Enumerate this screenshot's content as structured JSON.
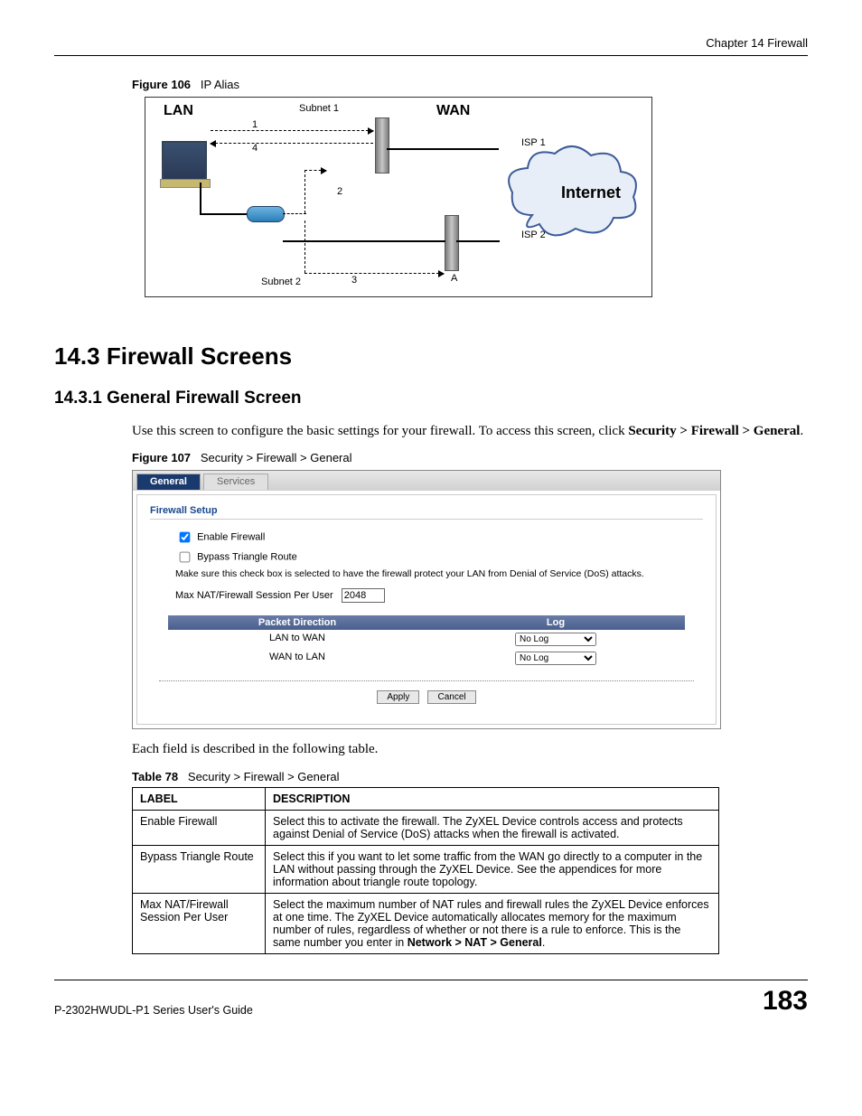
{
  "chapter_header": "Chapter 14 Firewall",
  "figure106": {
    "caption_label": "Figure 106",
    "caption_text": "IP Alias",
    "lan": "LAN",
    "wan": "WAN",
    "subnet1": "Subnet 1",
    "subnet2": "Subnet 2",
    "isp1": "ISP 1",
    "isp2": "ISP 2",
    "internet": "Internet",
    "n1": "1",
    "n2": "2",
    "n3": "3",
    "n4": "4",
    "nA": "A"
  },
  "section_heading": "14.3  Firewall Screens",
  "subsection_heading": "14.3.1  General Firewall Screen",
  "intro_text_1": "Use this screen to configure the basic settings for your firewall. To access this screen, click ",
  "intro_text_bold": "Security > Firewall > General",
  "intro_text_2": ".",
  "figure107": {
    "caption_label": "Figure 107",
    "caption_text": "Security > Firewall > General",
    "tab_general": "General",
    "tab_services": "Services",
    "section_title": "Firewall Setup",
    "enable_label": "Enable Firewall",
    "bypass_label": "Bypass Triangle Route",
    "note": "Make sure this check box is selected to have the firewall protect your LAN from Denial of Service (DoS) attacks.",
    "session_label": "Max NAT/Firewall Session Per User",
    "session_value": "2048",
    "hdr_packet": "Packet Direction",
    "hdr_log": "Log",
    "row1_dir": "LAN to WAN",
    "row1_log": "No Log",
    "row2_dir": "WAN to LAN",
    "row2_log": "No Log",
    "btn_apply": "Apply",
    "btn_cancel": "Cancel"
  },
  "after_fig_text": "Each field is described in the following table.",
  "table78": {
    "caption_label": "Table 78",
    "caption_text": "Security > Firewall > General",
    "hdr_label": "LABEL",
    "hdr_desc": "DESCRIPTION",
    "rows": [
      {
        "label": "Enable Firewall",
        "desc": "Select this to activate the firewall. The ZyXEL Device controls access and protects against Denial of Service (DoS) attacks when the firewall is activated."
      },
      {
        "label": "Bypass Triangle Route",
        "desc": "Select this if you want to let some traffic from the WAN go directly to a computer in the LAN without passing through the ZyXEL Device. See the appendices for more information about triangle route topology."
      },
      {
        "label": "Max NAT/Firewall Session Per User",
        "desc_pre": "Select the maximum number of NAT rules and firewall rules the ZyXEL Device enforces at one time. The ZyXEL Device automatically allocates memory for the maximum number of rules, regardless of whether or not there is a rule to enforce. This is the same number you enter in ",
        "desc_bold": "Network > NAT > General",
        "desc_post": "."
      }
    ]
  },
  "footer": {
    "guide": "P-2302HWUDL-P1 Series User's Guide",
    "page": "183"
  }
}
